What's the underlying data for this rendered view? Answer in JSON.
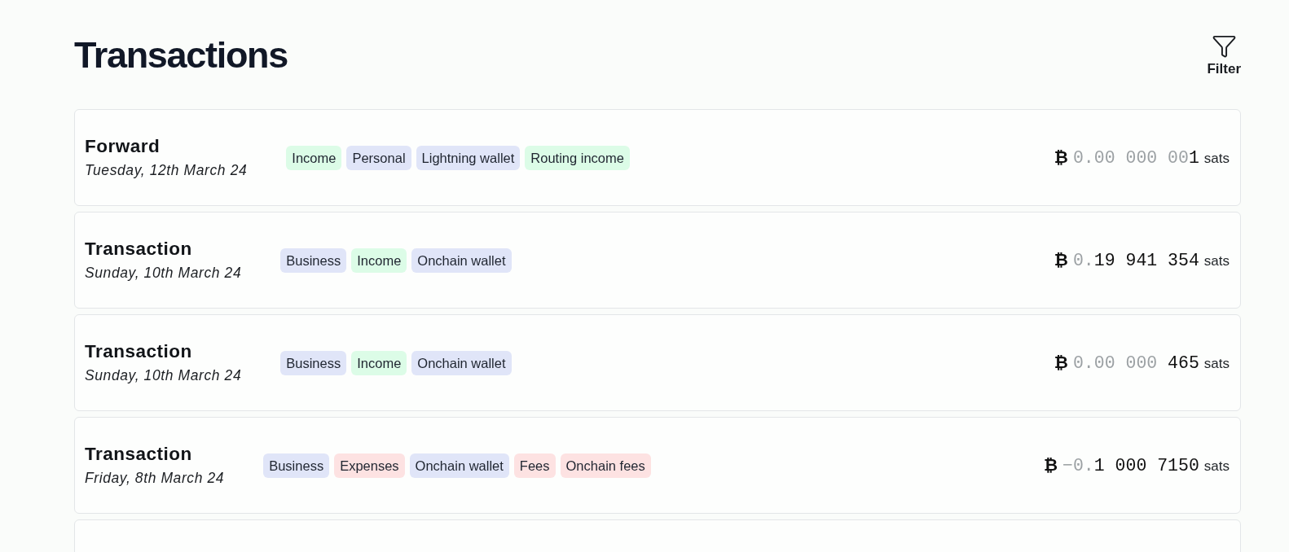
{
  "page": {
    "title": "Transactions"
  },
  "filter_button": {
    "label": "Filter"
  },
  "transactions": [
    {
      "title": "Forward",
      "date": "Tuesday, 12th March 24",
      "tags": [
        {
          "label": "Income",
          "color": "#dcfce7"
        },
        {
          "label": "Personal",
          "color": "#e0e5f8"
        },
        {
          "label": "Lightning wallet",
          "color": "#e0e5f8"
        },
        {
          "label": "Routing income",
          "color": "#dcfce7"
        }
      ],
      "amount": {
        "currency": "₿",
        "muted": "0.00 000 00",
        "value": "1",
        "unit": "sats"
      }
    },
    {
      "title": "Transaction",
      "date": "Sunday, 10th March 24",
      "tags": [
        {
          "label": "Business",
          "color": "#e0e5f8"
        },
        {
          "label": "Income",
          "color": "#dcfce7"
        },
        {
          "label": "Onchain wallet",
          "color": "#e0e5f8"
        }
      ],
      "amount": {
        "currency": "₿",
        "muted": "0.",
        "value": "19 941 354",
        "unit": "sats"
      }
    },
    {
      "title": "Transaction",
      "date": "Sunday, 10th March 24",
      "tags": [
        {
          "label": "Business",
          "color": "#e0e5f8"
        },
        {
          "label": "Income",
          "color": "#dcfce7"
        },
        {
          "label": "Onchain wallet",
          "color": "#e0e5f8"
        }
      ],
      "amount": {
        "currency": "₿",
        "muted": "0.00 000 ",
        "value": "465",
        "unit": "sats"
      }
    },
    {
      "title": "Transaction",
      "date": "Friday, 8th March 24",
      "tags": [
        {
          "label": "Business",
          "color": "#e0e5f8"
        },
        {
          "label": "Expenses",
          "color": "#fde2e2"
        },
        {
          "label": "Onchain wallet",
          "color": "#e0e5f8"
        },
        {
          "label": "Fees",
          "color": "#fde2e2"
        },
        {
          "label": "Onchain fees",
          "color": "#fde2e2"
        }
      ],
      "amount": {
        "currency": "₿",
        "muted": "−0.",
        "value": "1 000 7150",
        "unit": "sats"
      }
    }
  ],
  "more_below": true
}
